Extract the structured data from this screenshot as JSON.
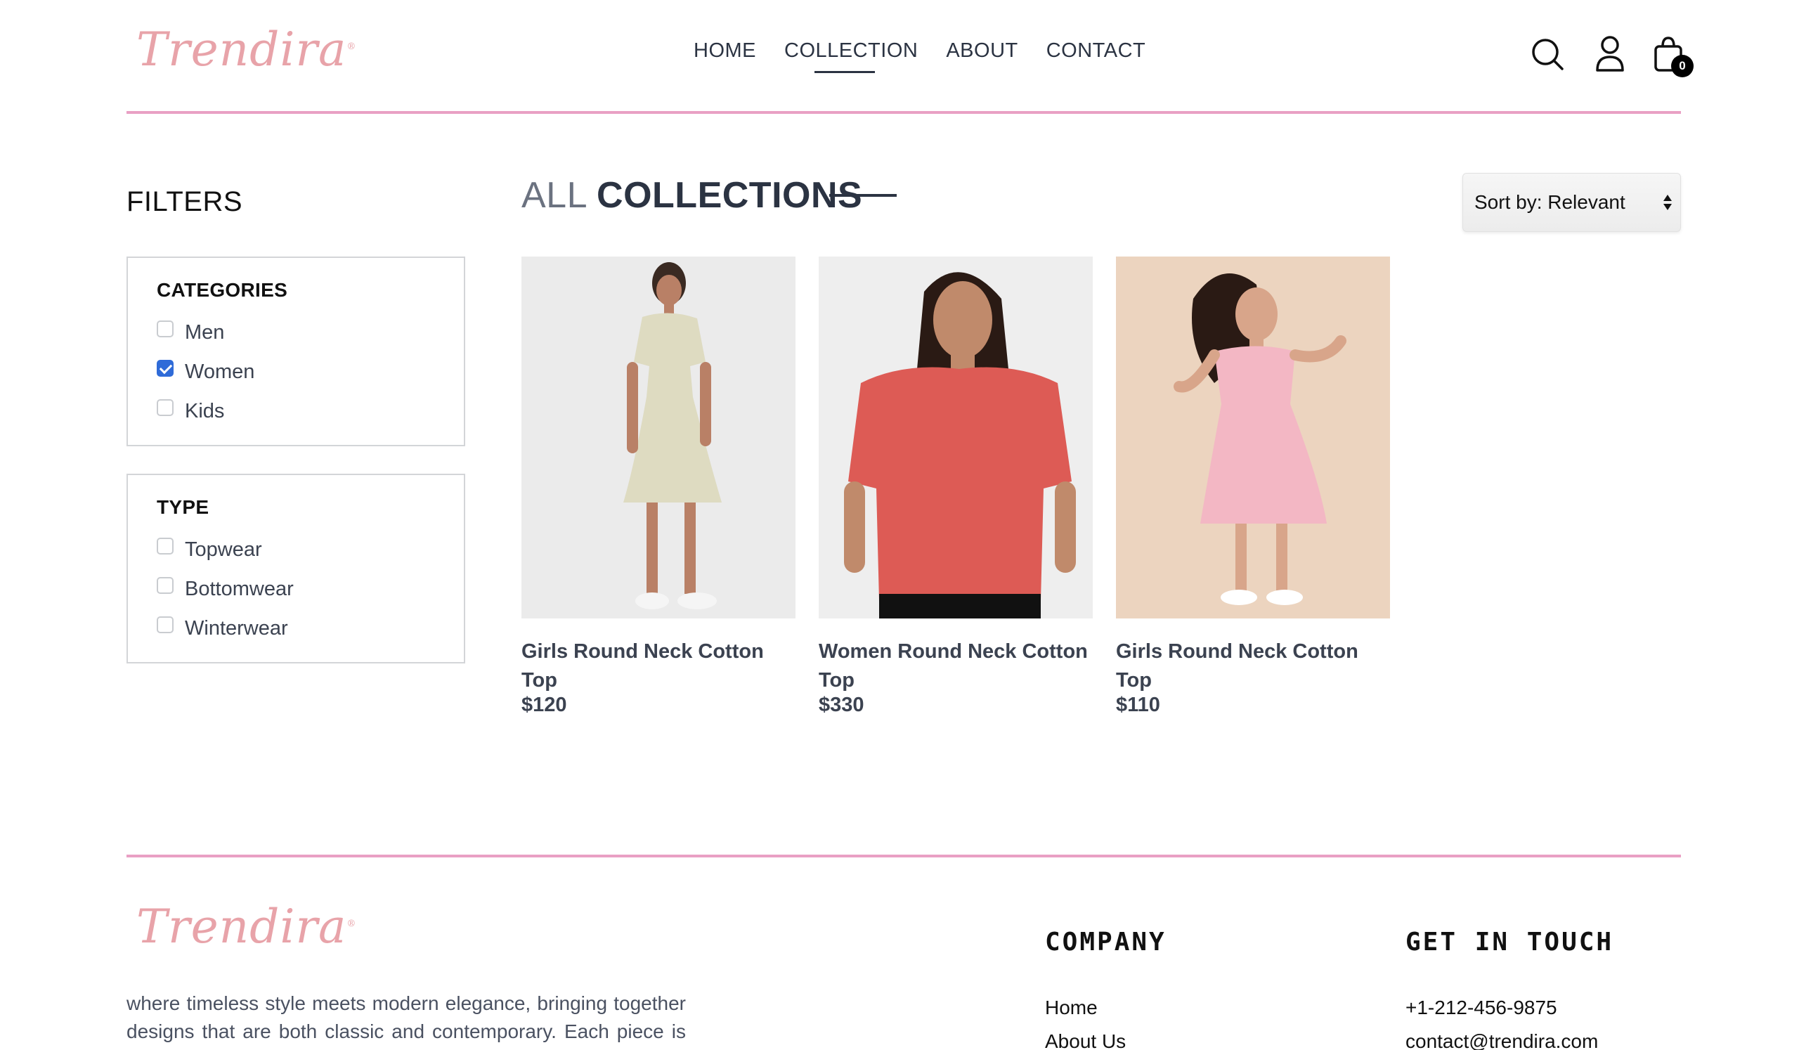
{
  "brand": {
    "name": "Trendira",
    "reg": "®"
  },
  "nav": {
    "items": [
      "HOME",
      "COLLECTION",
      "ABOUT",
      "CONTACT"
    ],
    "active": "COLLECTION"
  },
  "header": {
    "cart_count": "0"
  },
  "filters": {
    "title": "FILTERS",
    "categories": {
      "heading": "CATEGORIES",
      "options": [
        {
          "label": "Men",
          "checked": false
        },
        {
          "label": "Women",
          "checked": true
        },
        {
          "label": "Kids",
          "checked": false
        }
      ]
    },
    "type": {
      "heading": "TYPE",
      "options": [
        {
          "label": "Topwear",
          "checked": false
        },
        {
          "label": "Bottomwear",
          "checked": false
        },
        {
          "label": "Winterwear",
          "checked": false
        }
      ]
    }
  },
  "collection": {
    "title_light": "ALL",
    "title_bold": "COLLECTIONS",
    "sort_label": "Sort by: Relevant"
  },
  "products": [
    {
      "name": "Girls Round Neck Cotton Top",
      "price": "$120"
    },
    {
      "name": "Women Round Neck Cotton Top",
      "price": "$330"
    },
    {
      "name": "Girls Round Neck Cotton Top",
      "price": "$110"
    }
  ],
  "footer": {
    "about": "where timeless style meets modern elegance, bringing together designs that are both classic and contemporary. Each piece is thoughtfully crafted with remarkable quality and detail that",
    "company_heading": "COMPANY",
    "company_links": [
      "Home",
      "About Us"
    ],
    "contact_heading": "GET IN TOUCH",
    "contact_items": [
      "+1-212-456-9875",
      "contact@trendira.com"
    ]
  },
  "colors": {
    "accent_line": "#e9a0c4",
    "logo": "#e8a3a9",
    "text_dark": "#2b3342",
    "checkbox_checked": "#2f6bd8"
  },
  "icons": [
    "search-icon",
    "user-icon",
    "shopping-bag-icon"
  ]
}
